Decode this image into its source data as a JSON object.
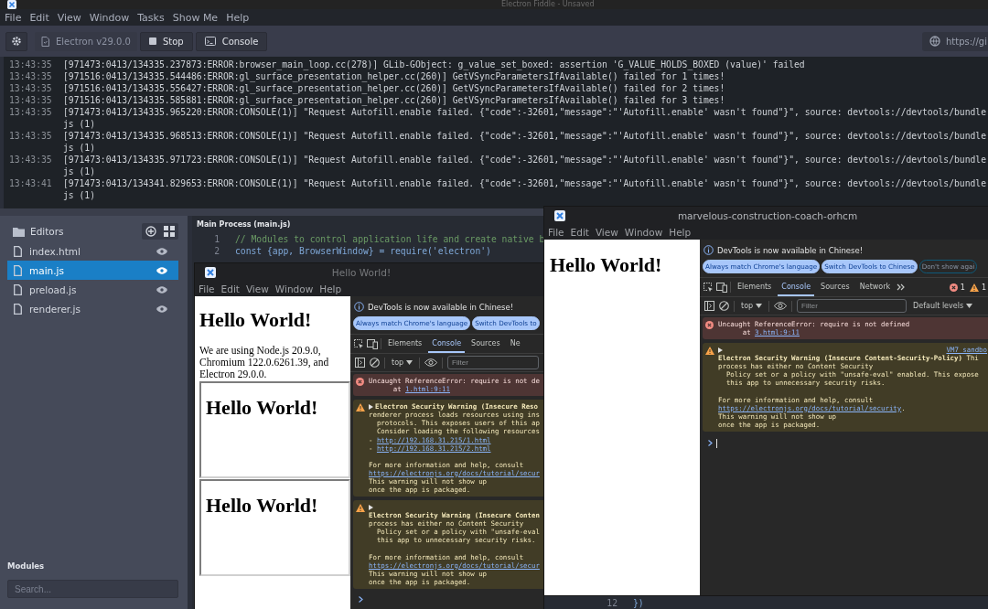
{
  "app": {
    "title": "Electron Fiddle - Unsaved",
    "menu": [
      "File",
      "Edit",
      "View",
      "Window",
      "Tasks",
      "Show Me",
      "Help"
    ],
    "toolbar": {
      "version": "Electron v29.0.0",
      "buttons": [
        {
          "label": "Stop",
          "kind": "stop"
        },
        {
          "label": "Console",
          "kind": "console"
        }
      ],
      "gist": "https://gi"
    },
    "console_log": [
      {
        "time": "13:43:35",
        "lines": [
          "[971473:0413/134335.237873:ERROR:browser_main_loop.cc(278)] GLib-GObject: g_value_set_boxed: assertion 'G_VALUE_HOLDS_BOXED (value)' failed"
        ]
      },
      {
        "time": "13:43:35",
        "lines": [
          "[971516:0413/134335.544486:ERROR:gl_surface_presentation_helper.cc(260)] GetVSyncParametersIfAvailable() failed for 1 times!"
        ]
      },
      {
        "time": "13:43:35",
        "lines": [
          "[971516:0413/134335.556427:ERROR:gl_surface_presentation_helper.cc(260)] GetVSyncParametersIfAvailable() failed for 2 times!"
        ]
      },
      {
        "time": "13:43:35",
        "lines": [
          "[971516:0413/134335.585881:ERROR:gl_surface_presentation_helper.cc(260)] GetVSyncParametersIfAvailable() failed for 3 times!"
        ]
      },
      {
        "time": "13:43:35",
        "lines": [
          "[971473:0413/134335.965220:ERROR:CONSOLE(1)] \"Request Autofill.enable failed. {\"code\":-32601,\"message\":\"'Autofill.enable' wasn't found\"}\", source: devtools://devtools/bundle",
          "js (1)"
        ]
      },
      {
        "time": "13:43:35",
        "lines": [
          "[971473:0413/134335.968513:ERROR:CONSOLE(1)] \"Request Autofill.enable failed. {\"code\":-32601,\"message\":\"'Autofill.enable' wasn't found\"}\", source: devtools://devtools/bundle",
          "js (1)"
        ]
      },
      {
        "time": "13:43:35",
        "lines": [
          "[971473:0413/134335.971723:ERROR:CONSOLE(1)] \"Request Autofill.enable failed. {\"code\":-32601,\"message\":\"'Autofill.enable' wasn't found\"}\", source: devtools://devtools/bundle",
          "js (1)"
        ]
      },
      {
        "time": "13:43:41",
        "lines": [
          "[971473:0413/134341.829653:ERROR:CONSOLE(1)] \"Request Autofill.enable failed. {\"code\":-32601,\"message\":\"'Autofill.enable' wasn't found\"}\", source: devtools://devtools/bundle",
          "js (1)"
        ]
      }
    ],
    "sidebar": {
      "title": "Editors",
      "files": [
        {
          "name": "index.html",
          "selected": false
        },
        {
          "name": "main.js",
          "selected": true
        },
        {
          "name": "preload.js",
          "selected": false
        },
        {
          "name": "renderer.js",
          "selected": false
        }
      ],
      "modules_title": "Modules",
      "search": {
        "placeholder": "Search..."
      }
    },
    "editor": {
      "title": "Main Process (main.js)",
      "lines": [
        {
          "number": "1",
          "code": "// Modules to control application life and create native b",
          "kind": "comment"
        },
        {
          "number": "2",
          "code": "const {app, BrowserWindow} = require('electron')",
          "kind": "code"
        }
      ]
    },
    "editor_2": {
      "lines": [
        {
          "number": "12",
          "code": "})"
        }
      ]
    }
  },
  "windows": [
    {
      "title": "Hello World!",
      "active": false,
      "menu": [
        "File",
        "Edit",
        "View",
        "Window",
        "Help"
      ],
      "page": [
        {
          "kind": "heading",
          "text": "Hello World!"
        },
        {
          "kind": "paragraph",
          "text": "We are using Node.js 20.9.0, Chromium 122.0.6261.39, and Electron 29.0.0."
        },
        {
          "kind": "frame",
          "text": "Hello World!"
        },
        {
          "kind": "frame",
          "text": "Hello World!"
        }
      ],
      "devtools": {
        "infobar": "DevTools is now available in Chinese!",
        "info_buttons": [
          {
            "label": "Always match Chrome's language",
            "kind": "filled"
          },
          {
            "label": "Switch DevTools to",
            "kind": "filled"
          }
        ],
        "tabs": [
          {
            "label": "Elements",
            "selected": false
          },
          {
            "label": "Console",
            "selected": true
          },
          {
            "label": "Sources",
            "selected": false
          },
          {
            "label": "Ne",
            "selected": false
          }
        ],
        "context": "top",
        "filter": {
          "placeholder": "Filter"
        },
        "prompt_caret": false,
        "messages": [
          {
            "kind": "error",
            "lines": [
              {
                "text": "Uncaught ReferenceError: require is not de"
              },
              {
                "pre": "      at ",
                "link": "1.html:9:11"
              }
            ]
          },
          {
            "kind": "warning",
            "heading_inline": true,
            "lines": [
              {
                "text": "Electron Security Warning (Insecure Reso",
                "kind": "heading"
              },
              {
                "text": "renderer process loads resources using ins"
              },
              {
                "text": "  protocols. This exposes users of this ap"
              },
              {
                "text": "  Consider loading the following resources"
              },
              {
                "pre": "- ",
                "link": "http://192.168.31.215/1.html"
              },
              {
                "pre": "- ",
                "link": "http://192.168.31.215/2.html"
              },
              {
                "text": "For more information and help, consult",
                "spaced": true
              },
              {
                "link": "https://electronjs.org/docs/tutorial/secur"
              },
              {
                "text": "This warning will not show up"
              },
              {
                "text": "once the app is packaged."
              }
            ]
          },
          {
            "kind": "warning",
            "heading_inline": false,
            "lines": [
              {
                "text": "Electron Security Warning (Insecure Conten",
                "kind": "heading"
              },
              {
                "text": "process has either no Content Security"
              },
              {
                "text": "  Policy set or a policy with \"unsafe-eval"
              },
              {
                "text": "  this app to unnecessary security risks."
              },
              {
                "text": "For more information and help, consult",
                "spaced": true
              },
              {
                "link": "https://electronjs.org/docs/tutorial/secur"
              },
              {
                "text": "This warning will not show up"
              },
              {
                "text": "once the app is packaged."
              }
            ]
          }
        ]
      }
    },
    {
      "title": "marvelous-construction-coach-orhcm",
      "active": true,
      "menu": [
        "File",
        "Edit",
        "View",
        "Window",
        "Help"
      ],
      "page": [
        {
          "kind": "heading",
          "text": "Hello World!"
        }
      ],
      "devtools": {
        "infobar": "DevTools is now available in Chinese!",
        "info_buttons": [
          {
            "label": "Always match Chrome's language",
            "kind": "filled"
          },
          {
            "label": "Switch DevTools to Chinese",
            "kind": "filled"
          },
          {
            "label": "Don't show agai",
            "kind": "outline"
          }
        ],
        "tabs": [
          {
            "label": "Elements",
            "selected": false
          },
          {
            "label": "Console",
            "selected": true
          },
          {
            "label": "Sources",
            "selected": false
          },
          {
            "label": "Network",
            "selected": false
          }
        ],
        "overflow_tabs": true,
        "issue_counts": {
          "errors": "1",
          "warnings": "1"
        },
        "context": "top",
        "filter": {
          "placeholder": "Filter"
        },
        "levels": "Default levels",
        "prompt_caret": true,
        "messages": [
          {
            "kind": "error",
            "lines": [
              {
                "text": "Uncaught ReferenceError: require is not defined"
              },
              {
                "pre": "      at ",
                "link": "3.html:9:11"
              }
            ]
          },
          {
            "kind": "warning",
            "heading_inline": false,
            "source": "VM7 sandbo",
            "lines": [
              {
                "text": "**Electron Security Warning (Insecure Content-Security-Policy)** Thi"
              },
              {
                "text": "process has either no Content Security"
              },
              {
                "text": "  Policy set or a policy with \"unsafe-eval\" enabled. This expose"
              },
              {
                "text": "  this app to unnecessary security risks."
              },
              {
                "text": "For more information and help, consult",
                "spaced": true
              },
              {
                "link": "https://electronjs.org/docs/tutorial/security",
                "post": "."
              },
              {
                "text": "This warning will not show up"
              },
              {
                "text": "once the app is packaged."
              }
            ]
          }
        ]
      }
    }
  ]
}
